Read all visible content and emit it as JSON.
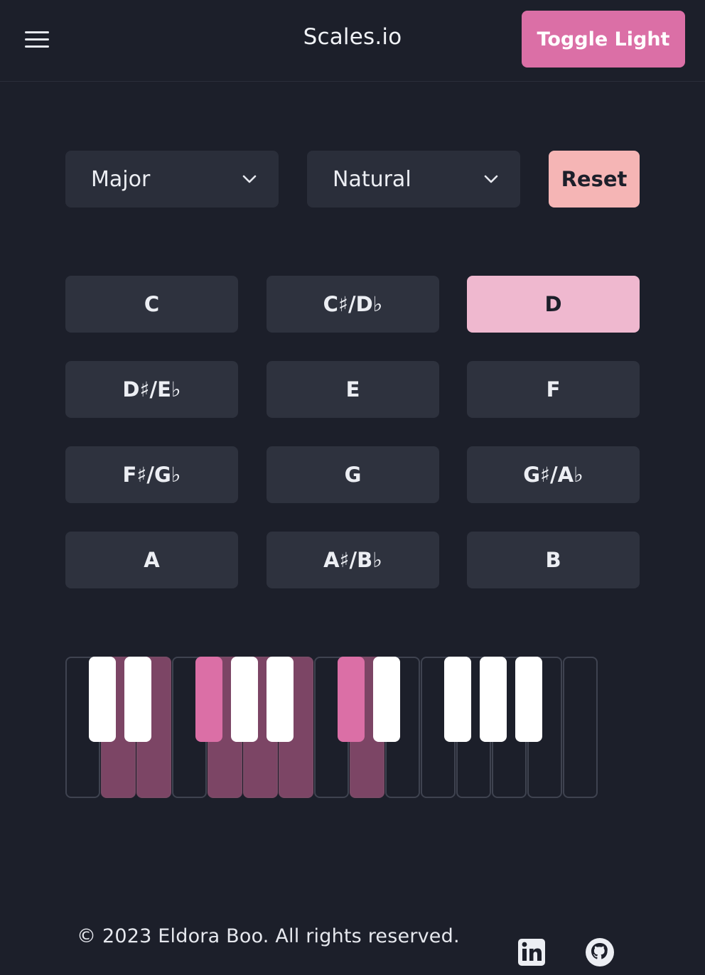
{
  "header": {
    "menu_icon": "hamburger-menu-icon",
    "brand": "Scales.io",
    "toggle_label": "Toggle Light",
    "accent_color": "#db6fa6"
  },
  "controls": {
    "scale_select": {
      "value": "Major",
      "icon": "chevron-down-icon"
    },
    "mode_select": {
      "value": "Natural",
      "icon": "chevron-down-icon"
    },
    "reset_label": "Reset",
    "reset_color": "#f5b5b5"
  },
  "keys": {
    "selected": "D",
    "items": [
      "C",
      "C♯/D♭",
      "D",
      "D♯/E♭",
      "E",
      "F",
      "F♯/G♭",
      "G",
      "G♯/A♭",
      "A",
      "A♯/B♭",
      "B"
    ]
  },
  "piano": {
    "white_keys": 15,
    "highlighted_white_keys": [
      1,
      2,
      4,
      5,
      6,
      8
    ],
    "black_keys_shown": 10,
    "highlighted_black_keys": [
      2,
      5
    ],
    "highlight_color": "#db6fa6"
  },
  "footer": {
    "copyright": "© 2023 Eldora Boo. All rights reserved.",
    "links": [
      "linkedin-icon",
      "github-icon"
    ]
  }
}
